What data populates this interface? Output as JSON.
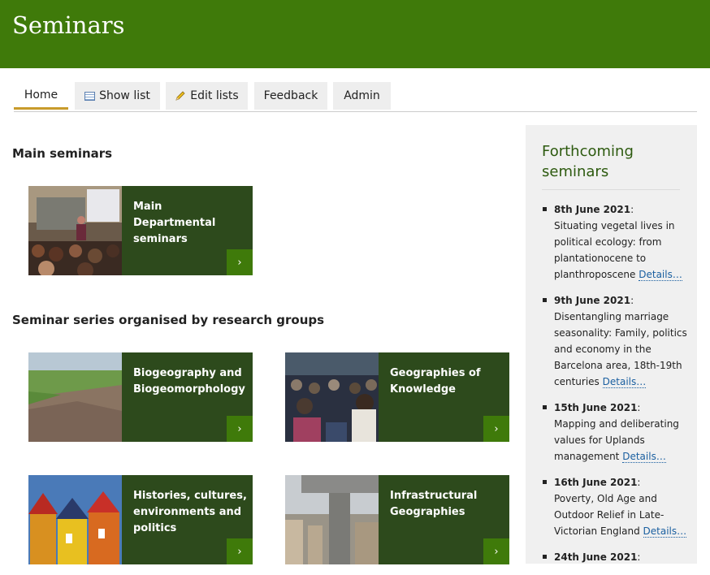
{
  "site": {
    "title": "Seminars"
  },
  "tabs": [
    {
      "label": "Home",
      "icon": "",
      "active": true
    },
    {
      "label": "Show list",
      "icon": "list-icon"
    },
    {
      "label": "Edit lists",
      "icon": "pencil-icon"
    },
    {
      "label": "Feedback",
      "icon": ""
    },
    {
      "label": "Admin",
      "icon": ""
    }
  ],
  "main": {
    "heading": "Main seminars",
    "cards": [
      {
        "title": "Main Departmental seminars",
        "arrow": "›"
      }
    ]
  },
  "groups": {
    "heading": "Seminar series organised by research groups",
    "cards": [
      {
        "title": "Biogeography and Biogeomorphology",
        "arrow": "›"
      },
      {
        "title": "Geographies of Knowledge",
        "arrow": "›"
      },
      {
        "title": "Histories, cultures, environments and politics",
        "arrow": "›"
      },
      {
        "title": "Infrastructural Geographies",
        "arrow": "›"
      }
    ]
  },
  "sidebar": {
    "title": "Forthcoming seminars",
    "events": [
      {
        "date": "8th June 2021",
        "sep": ":",
        "text": "Situating vegetal lives in political ecology: from plantationocene to planthroposcene",
        "link": "Details…"
      },
      {
        "date": "9th June 2021",
        "sep": ":",
        "text": "Disentangling marriage seasonality: Family, politics and economy in the Barcelona area, 18th-19th centuries",
        "link": "Details…"
      },
      {
        "date": "15th June 2021",
        "sep": ":",
        "text": "Mapping and deliberating values for Uplands management",
        "link": "Details…"
      },
      {
        "date": "16th June 2021",
        "sep": ":",
        "text": "Poverty, Old Age and Outdoor Relief in Late-Victorian England",
        "link": "Details…"
      },
      {
        "date": "24th June 2021",
        "sep": ":",
        "text": "",
        "link": ""
      }
    ]
  },
  "colors": {
    "header": "#3f7a0a",
    "card_panel": "#2d4a1c",
    "tab_active_underline": "#c89b2b",
    "link": "#1a5fa0"
  }
}
